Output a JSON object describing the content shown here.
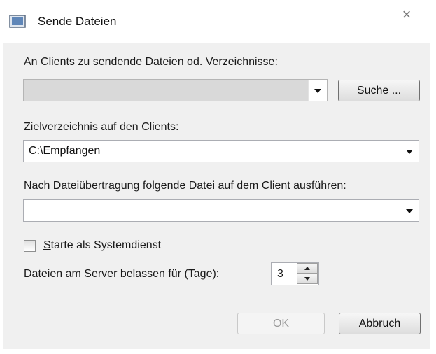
{
  "window": {
    "title": "Sende Dateien",
    "icon": "window-icon",
    "close_symbol": "×"
  },
  "files_section": {
    "label": "An Clients zu sendende Dateien od. Verzeichnisse:",
    "value": "",
    "search_button": "Suche ..."
  },
  "target_dir": {
    "label": "Zielverzeichnis auf den Clients:",
    "value": "C:\\Empfangen"
  },
  "run_after": {
    "label": "Nach Dateiübertragung folgende Datei auf dem Client ausführen:",
    "value": ""
  },
  "service_checkbox": {
    "mnemonic": "S",
    "rest": "tarte als Systemdienst",
    "checked": false
  },
  "keep_days": {
    "label": "Dateien am Server belassen für (Tage):",
    "value": "3"
  },
  "buttons": {
    "ok": "OK",
    "cancel": "Abbruch"
  }
}
